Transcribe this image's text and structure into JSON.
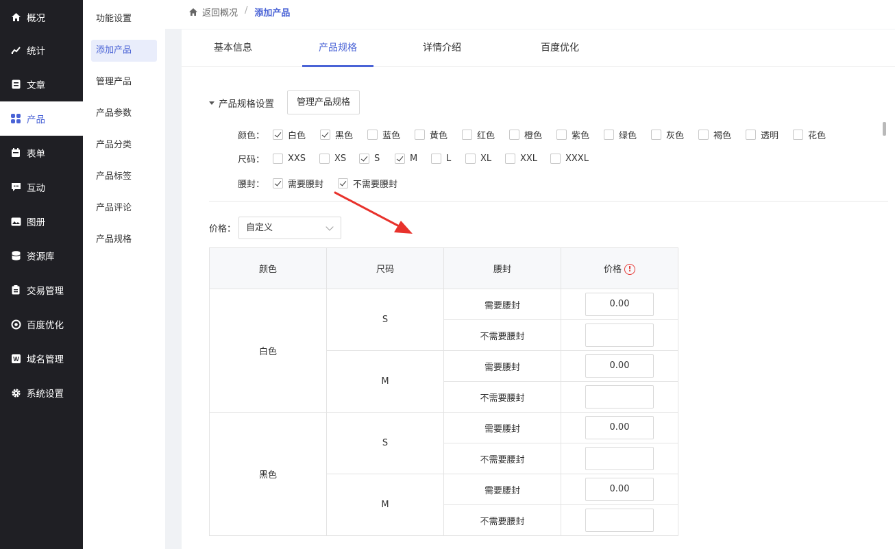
{
  "nav": [
    {
      "label": "概况",
      "icon": "home-icon"
    },
    {
      "label": "统计",
      "icon": "chart-icon"
    },
    {
      "label": "文章",
      "icon": "article-icon"
    },
    {
      "label": "产品",
      "icon": "grid-icon"
    },
    {
      "label": "表单",
      "icon": "calendar-icon"
    },
    {
      "label": "互动",
      "icon": "chat-icon"
    },
    {
      "label": "图册",
      "icon": "album-icon"
    },
    {
      "label": "资源库",
      "icon": "database-icon"
    },
    {
      "label": "交易管理",
      "icon": "clipboard-icon"
    },
    {
      "label": "百度优化",
      "icon": "target-icon"
    },
    {
      "label": "域名管理",
      "icon": "domain-icon"
    },
    {
      "label": "系统设置",
      "icon": "gear-icon"
    }
  ],
  "subnav": [
    "功能设置",
    "添加产品",
    "管理产品",
    "产品参数",
    "产品分类",
    "产品标签",
    "产品评论",
    "产品规格"
  ],
  "breadcrumb": {
    "back": "返回概况",
    "current": "添加产品"
  },
  "tabs": [
    "基本信息",
    "产品规格",
    "详情介绍",
    "百度优化"
  ],
  "spec": {
    "title": "产品规格设置",
    "manage_button": "管理产品规格",
    "color_label": "颜色：",
    "colors": [
      "白色",
      "黑色",
      "蓝色",
      "黄色",
      "红色",
      "橙色",
      "紫色",
      "绿色",
      "灰色",
      "褐色",
      "透明",
      "花色"
    ],
    "size_label": "尺码：",
    "sizes": [
      "XXS",
      "XS",
      "S",
      "M",
      "L",
      "XL",
      "XXL",
      "XXXL"
    ],
    "belt_label": "腰封：",
    "belts": [
      "需要腰封",
      "不需要腰封"
    ]
  },
  "price": {
    "label": "价格：",
    "mode": "自定义"
  },
  "table": {
    "headers": [
      "颜色",
      "尺码",
      "腰封",
      "价格"
    ],
    "warn_symbol": "!",
    "rows": [
      {
        "color": "白色",
        "size": "S",
        "belt": "需要腰封",
        "price": "0.00"
      },
      {
        "color": "白色",
        "size": "S",
        "belt": "不需要腰封",
        "price": ""
      },
      {
        "color": "白色",
        "size": "M",
        "belt": "需要腰封",
        "price": "0.00"
      },
      {
        "color": "白色",
        "size": "M",
        "belt": "不需要腰封",
        "price": ""
      },
      {
        "color": "黑色",
        "size": "S",
        "belt": "需要腰封",
        "price": "0.00"
      },
      {
        "color": "黑色",
        "size": "S",
        "belt": "不需要腰封",
        "price": ""
      },
      {
        "color": "黑色",
        "size": "M",
        "belt": "需要腰封",
        "price": "0.00"
      },
      {
        "color": "黑色",
        "size": "M",
        "belt": "不需要腰封",
        "price": ""
      }
    ]
  },
  "colors": {
    "accent": "#4a63d6",
    "nav_bg": "#1f1f24",
    "arrow": "#e8322c"
  }
}
